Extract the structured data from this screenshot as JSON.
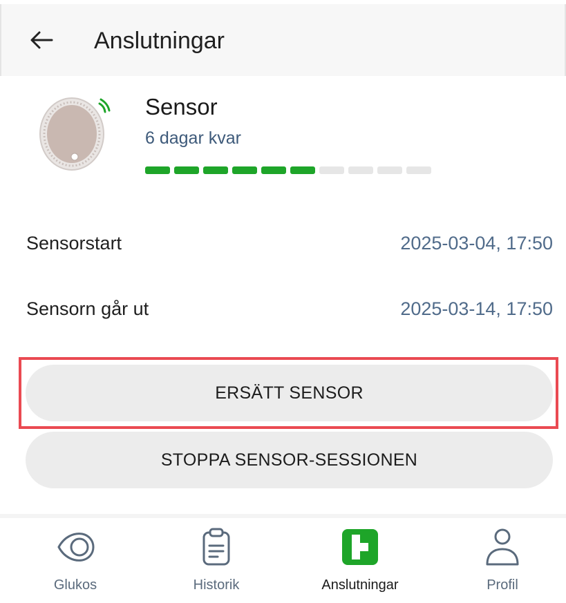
{
  "app_bar": {
    "title": "Anslutningar",
    "back_icon": "arrow-left-icon"
  },
  "sensor": {
    "name": "Sensor",
    "remaining": "6 dagar kvar",
    "progress_total_segments": 10,
    "progress_filled_segments": 6,
    "progress_color": "#1ea529",
    "icon_color": "#1ea529"
  },
  "details": {
    "start_label": "Sensorstart",
    "start_value": "2025-03-04, 17:50",
    "expiry_label": "Sensorn går ut",
    "expiry_value": "2025-03-14, 17:50"
  },
  "actions": {
    "replace_label": "ERSÄTT SENSOR",
    "stop_label": "STOPPA SENSOR-SESSIONEN"
  },
  "bottom_nav": {
    "items": [
      {
        "label": "Glukos",
        "icon": "eye-icon",
        "active": false
      },
      {
        "label": "Historik",
        "icon": "clipboard-icon",
        "active": false
      },
      {
        "label": "Anslutningar",
        "icon": "connections-icon",
        "active": true
      },
      {
        "label": "Profil",
        "icon": "person-icon",
        "active": false
      }
    ]
  },
  "colors": {
    "accent_green": "#1ea529",
    "highlight_red": "#ea4a52",
    "value_blue": "#506b8a"
  }
}
